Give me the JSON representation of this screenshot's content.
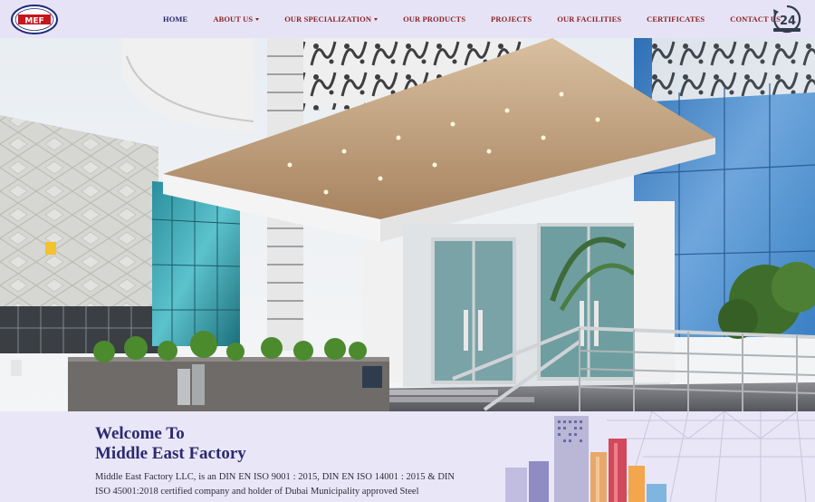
{
  "header": {
    "logo_text": "MEF",
    "nav": [
      {
        "label": "HOME",
        "has_dropdown": false
      },
      {
        "label": "ABOUT US",
        "has_dropdown": true
      },
      {
        "label": "OUR SPECIALIZATION",
        "has_dropdown": true
      },
      {
        "label": "OUR PRODUCTS",
        "has_dropdown": false
      },
      {
        "label": "PROJECTS",
        "has_dropdown": false
      },
      {
        "label": "OUR FACILITIES",
        "has_dropdown": false
      },
      {
        "label": "CERTIFICATES",
        "has_dropdown": false
      },
      {
        "label": "CONTACT US",
        "has_dropdown": false
      }
    ],
    "badge_number": "24"
  },
  "content": {
    "title_line1": "Welcome To",
    "title_line2": "Middle East Factory",
    "intro": "Middle East Factory LLC, is an DIN EN ISO 9001 : 2015, DIN EN ISO 14001 : 2015 & DIN ISO 45001:2018 certified company and holder of Dubai Municipality approved Steel"
  },
  "colors": {
    "nav_text": "#8b2424",
    "nav_home": "#2a2466",
    "title": "#2c2970",
    "background": "#e9e6f7"
  }
}
